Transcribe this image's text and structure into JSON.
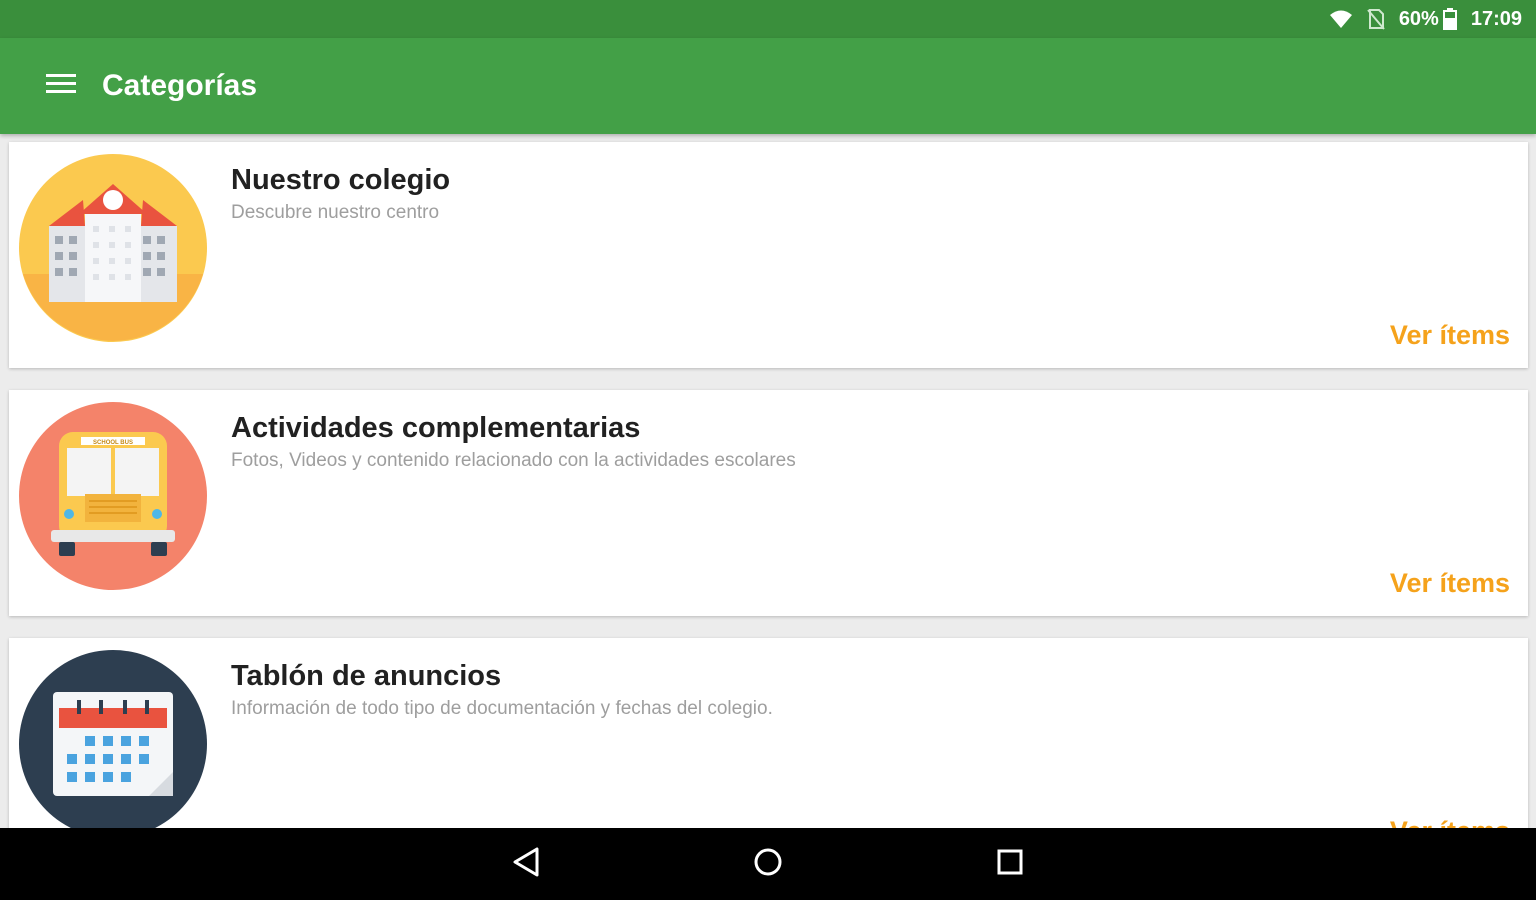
{
  "status_bar": {
    "battery": "60%",
    "time": "17:09",
    "icons": [
      "wifi-icon",
      "no-sim-icon",
      "battery-icon"
    ]
  },
  "app_bar": {
    "title": "Categorías",
    "menu_icon": "menu-icon"
  },
  "categories": [
    {
      "title": "Nuestro colegio",
      "subtitle": "Descubre nuestro centro",
      "action": "Ver ítems",
      "icon": "school-building-icon",
      "icon_bg": "#fbc94f"
    },
    {
      "title": "Actividades complementarias",
      "subtitle": "Fotos, Videos y contenido relacionado con la actividades escolares",
      "action": "Ver ítems",
      "icon": "school-bus-icon",
      "icon_bg": "#f4836a",
      "bus_label": "SCHOOL BUS"
    },
    {
      "title": "Tablón de anuncios",
      "subtitle": "Información de todo tipo de documentación y fechas del colegio.",
      "action": "Ver ítems",
      "icon": "calendar-icon",
      "icon_bg": "#2d3e50"
    }
  ],
  "nav_bar": {
    "icons": [
      "back-icon",
      "home-icon",
      "recents-icon"
    ]
  },
  "colors": {
    "status_bar": "#3a8f3c",
    "app_bar": "#43a047",
    "accent": "#f5a21b"
  }
}
